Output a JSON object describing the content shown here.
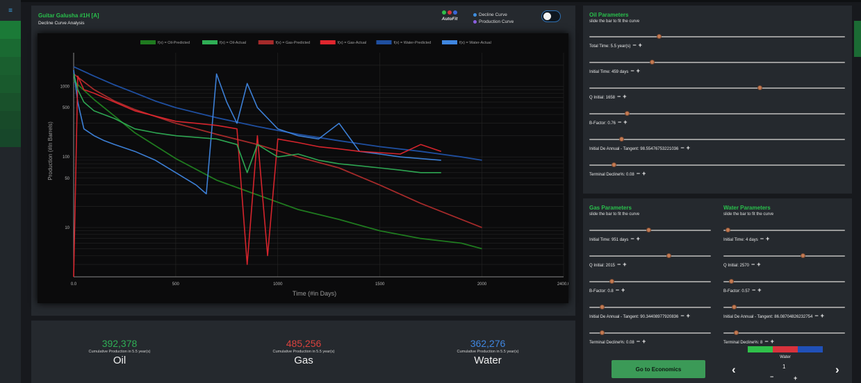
{
  "chart_panel": {
    "title": "Guitar Galusha #1H [A]",
    "subtitle": "Decline Curve Analysis",
    "autofit_label": "AutoFit",
    "autofit_dot_colors": [
      "#2fc04a",
      "#d8323c",
      "#3b66d8"
    ],
    "curve_options": [
      {
        "label": "Decline Curve",
        "color": "#3f8fe0"
      },
      {
        "label": "Production Curve",
        "color": "#8b5fe0"
      }
    ],
    "toggle_on": false
  },
  "chart_data": {
    "type": "line",
    "ylabel": "Production (#In Barrels)",
    "xlabel": "Time (#in Days)",
    "y_scale": "log",
    "xlim": [
      0,
      2400
    ],
    "x_ticks": [
      "0.0",
      "500",
      "1000",
      "1500",
      "2000",
      "2400.0"
    ],
    "y_ticks": [
      "1000",
      "500",
      "100",
      "50",
      "10"
    ],
    "grid": true,
    "legend_placement": "top-center",
    "legend": [
      {
        "label": "f(x) = Oil-Predicted",
        "color": "#1f7a1f"
      },
      {
        "label": "f(x) = Oil-Actual",
        "color": "#2fae55"
      },
      {
        "label": "f(x) = Gas-Predicted",
        "color": "#a52a2a"
      },
      {
        "label": "f(x) = Gas-Actual",
        "color": "#e0262e"
      },
      {
        "label": "f(x) = Water-Predicted",
        "color": "#1f4fa0"
      },
      {
        "label": "f(x) = Water-Actual",
        "color": "#3f86e0"
      }
    ],
    "series": [
      {
        "name": "f(x) = Water-Predicted",
        "color": "#1f4fa0",
        "x": [
          0,
          100,
          200,
          300,
          400,
          500,
          700,
          900,
          1100,
          1300,
          1500,
          1700,
          1900,
          2000
        ],
        "y": [
          1900,
          1400,
          1050,
          810,
          620,
          500,
          360,
          270,
          210,
          170,
          140,
          120,
          100,
          90
        ]
      },
      {
        "name": "f(x) = Gas-Predicted",
        "color": "#a52a2a",
        "x": [
          0,
          100,
          200,
          300,
          500,
          700,
          900,
          1100,
          1300,
          1500,
          1700,
          1900,
          2000
        ],
        "y": [
          1500,
          900,
          620,
          470,
          300,
          210,
          150,
          100,
          70,
          40,
          22,
          13,
          10
        ]
      },
      {
        "name": "f(x) = Oil-Predicted",
        "color": "#1f7a1f",
        "x": [
          0,
          100,
          200,
          300,
          500,
          700,
          900,
          1100,
          1300,
          1500,
          1700,
          1900,
          2000
        ],
        "y": [
          1200,
          650,
          380,
          220,
          95,
          47,
          29,
          18,
          13,
          9,
          7,
          6,
          5
        ]
      },
      {
        "name": "f(x) = Water-Actual",
        "color": "#3f86e0",
        "x": [
          0,
          20,
          50,
          100,
          150,
          200,
          300,
          400,
          500,
          600,
          650,
          700,
          750,
          800,
          850,
          900,
          1000,
          1100,
          1200,
          1300,
          1400,
          1500,
          1600,
          1800
        ],
        "y": [
          1700,
          600,
          250,
          200,
          170,
          150,
          120,
          90,
          60,
          40,
          30,
          1500,
          600,
          300,
          1100,
          500,
          250,
          200,
          180,
          300,
          120,
          110,
          100,
          90
        ]
      },
      {
        "name": "f(x) = Gas-Actual",
        "color": "#e0262e",
        "x": [
          0,
          20,
          50,
          100,
          200,
          300,
          400,
          500,
          600,
          700,
          800,
          850,
          900,
          950,
          1000,
          1100,
          1200,
          1300,
          1400,
          1500,
          1600,
          1700,
          1800
        ],
        "y": [
          2,
          1400,
          900,
          800,
          600,
          450,
          380,
          320,
          300,
          280,
          250,
          3,
          200,
          4,
          180,
          160,
          140,
          130,
          120,
          115,
          110,
          150,
          120
        ]
      },
      {
        "name": "f(x) = Oil-Actual",
        "color": "#2fae55",
        "x": [
          0,
          20,
          50,
          100,
          200,
          300,
          400,
          500,
          600,
          700,
          800,
          850,
          900,
          1000,
          1100,
          1200,
          1300,
          1400,
          1500,
          1600,
          1700,
          1800
        ],
        "y": [
          1500,
          900,
          600,
          450,
          350,
          250,
          220,
          200,
          190,
          180,
          150,
          60,
          150,
          100,
          110,
          90,
          80,
          75,
          70,
          65,
          60,
          60
        ]
      }
    ]
  },
  "cumulative": [
    {
      "value": "392,378",
      "note": "Cumulative Production in 5.5 year(s)",
      "name": "Oil",
      "color": "#2fae55"
    },
    {
      "value": "485,256",
      "note": "Cumulative Production in 5.5 year(s)",
      "name": "Gas",
      "color": "#d8423e"
    },
    {
      "value": "362,276",
      "note": "Cumulative Production in 5.5 year(s)",
      "name": "Water",
      "color": "#3f86e0"
    }
  ],
  "oil_params": {
    "title": "Oil Parameters",
    "subtitle": "slide the bar to fit the curve",
    "sliders": [
      {
        "label": "Total Time: 5.5 year(s)",
        "position": 0.27
      },
      {
        "label": "Initial Time: 459 days",
        "position": 0.24
      },
      {
        "label": "Q Initial: 1658",
        "position": 0.67
      },
      {
        "label": "B-Factor: 0.76",
        "position": 0.14
      },
      {
        "label": "Initial De Annual - Tangent: 98.55476753221036",
        "position": 0.12
      },
      {
        "label": "Terminal Decline%: 0.08",
        "position": 0.09
      }
    ]
  },
  "gas_params": {
    "title": "Gas Parameters",
    "subtitle": "slide the bar to fit the curve",
    "sliders": [
      {
        "label": "Initial Time: 951 days",
        "position": 0.49
      },
      {
        "label": "Q Initial: 2015",
        "position": 0.66
      },
      {
        "label": "B-Factor: 0.8",
        "position": 0.17
      },
      {
        "label": "Initial De Annual - Tangent: 90.34408977920836",
        "position": 0.09
      },
      {
        "label": "Terminal Decline%: 0.08",
        "position": 0.09
      }
    ]
  },
  "water_params": {
    "title": "Water Parameters",
    "subtitle": "slide the bar to fit the curve",
    "sliders": [
      {
        "label": "Initial Time: 4 days",
        "position": 0.02
      },
      {
        "label": "Q Initial: 2570",
        "position": 0.66
      },
      {
        "label": "B-Factor: 0.57",
        "position": 0.05
      },
      {
        "label": "Initial De Annual - Tangent: 86.08704826232754",
        "position": 0.07
      },
      {
        "label": "Terminal Decline%: 8",
        "position": 0.09
      }
    ]
  },
  "footer": {
    "economics_button": "Go to Economics",
    "series_colors": [
      "#2fc04a",
      "#d8323c",
      "#2050b8"
    ],
    "selected_series": "Water",
    "page_number": "1",
    "prev_icon": "‹",
    "next_icon": "›",
    "minus": "−",
    "plus": "+"
  },
  "sidebar": {
    "menu_icon": "≡",
    "stripe_colors": [
      "#1b7a37",
      "#1a6a32",
      "#1a5f2f",
      "#195a2d",
      "#19512b",
      "#184a29",
      "#17472a"
    ]
  }
}
